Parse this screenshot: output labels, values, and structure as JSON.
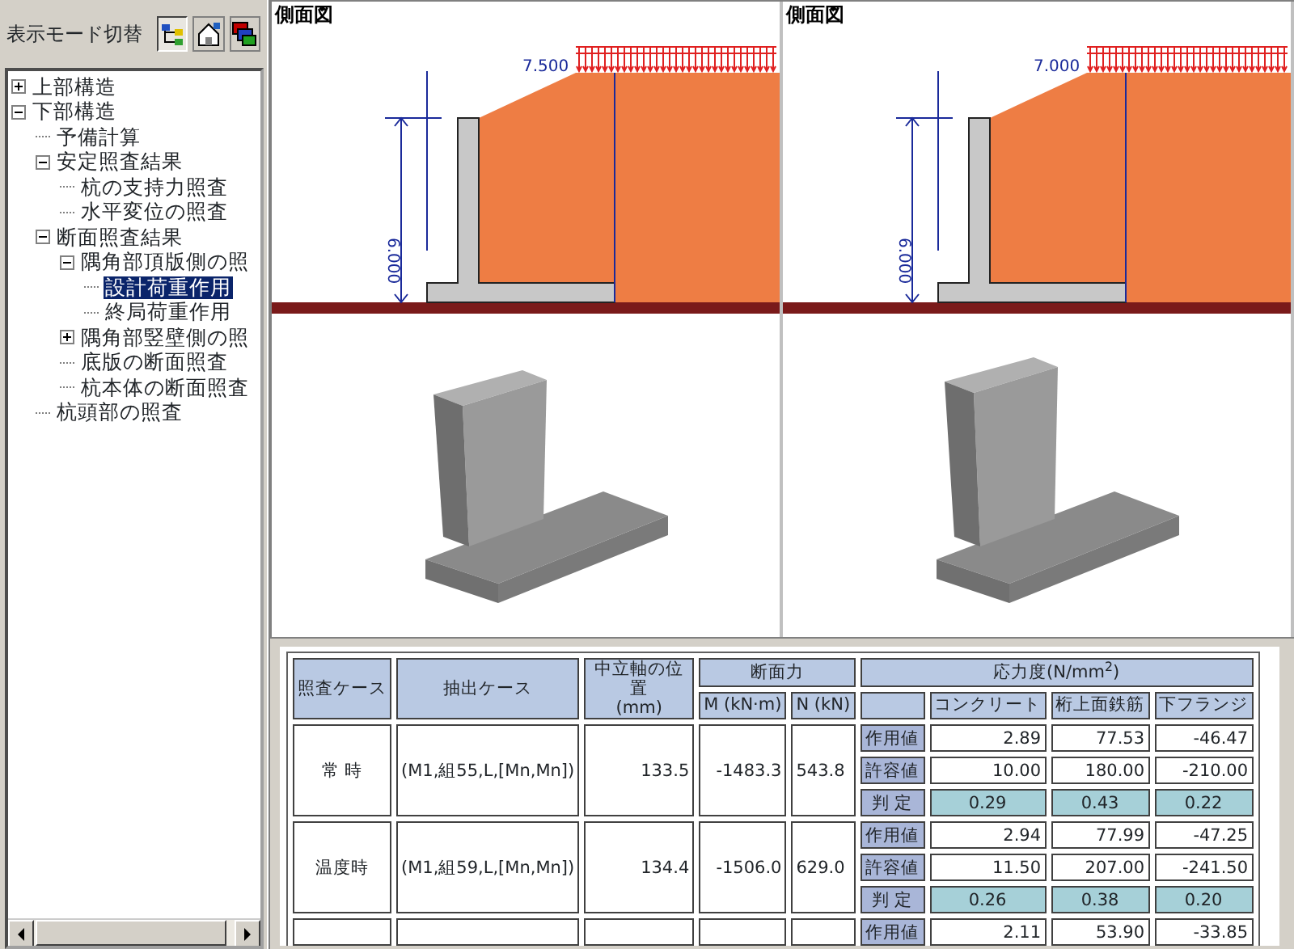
{
  "toolbar": {
    "label": "表示モード切替",
    "buttons": [
      {
        "kind": "tree",
        "selected": true
      },
      {
        "kind": "house",
        "selected": false
      },
      {
        "kind": "layers",
        "selected": false
      }
    ]
  },
  "tree": [
    {
      "label": "上部構造",
      "expanded": false,
      "selected": false
    },
    {
      "label": "下部構造",
      "expanded": true,
      "selected": false,
      "children": [
        {
          "label": "予備計算",
          "selected": false
        },
        {
          "label": "安定照査結果",
          "expanded": true,
          "selected": false,
          "children": [
            {
              "label": "杭の支持力照査",
              "selected": false
            },
            {
              "label": "水平変位の照査",
              "selected": false
            }
          ]
        },
        {
          "label": "断面照査結果",
          "expanded": true,
          "selected": false,
          "children": [
            {
              "label": "隅角部頂版側の照",
              "expanded": true,
              "selected": false,
              "children": [
                {
                  "label": "設計荷重作用",
                  "selected": true
                },
                {
                  "label": "終局荷重作用",
                  "selected": false
                }
              ]
            },
            {
              "label": "隅角部竪壁側の照",
              "expanded": false,
              "selected": false
            },
            {
              "label": "底版の断面照査",
              "selected": false
            },
            {
              "label": "杭本体の断面照査",
              "selected": false
            }
          ]
        },
        {
          "label": "杭頭部の照査",
          "selected": false
        }
      ]
    }
  ],
  "views": [
    {
      "title": "側面図",
      "width_label": "7.500",
      "height_label": "6.000"
    },
    {
      "title": "側面図",
      "width_label": "7.000",
      "height_label": "6.000"
    }
  ],
  "table": {
    "headers": {
      "case": "照査ケース",
      "extract": "抽出ケース",
      "neutral": "中立軸の位置\n(mm)",
      "force": "断面力",
      "moment": "M (kN·m)",
      "axial": "N (kN)",
      "stress": "応力度(N/mm$^{2}$)",
      "stress_cols": [
        "コンクリート",
        "桁上面鉄筋",
        "下フランジ"
      ]
    },
    "rows": [
      {
        "case": "常 時",
        "extract": "(M1,組55,L,[Mn,Mn])",
        "neutral": "133.5",
        "moment": "-1483.3",
        "axial": "543.8",
        "sub": [
          {
            "kind": "value",
            "label": "作用値",
            "values": [
              "2.89",
              "77.53",
              "-46.47"
            ]
          },
          {
            "kind": "value",
            "label": "許容値",
            "values": [
              "10.00",
              "180.00",
              "-210.00"
            ]
          },
          {
            "kind": "ratio",
            "label": "判 定",
            "values": [
              "0.29",
              "0.43",
              "0.22"
            ]
          }
        ]
      },
      {
        "case": "温度時",
        "extract": "(M1,組59,L,[Mn,Mn])",
        "neutral": "134.4",
        "moment": "-1506.0",
        "axial": "629.0",
        "sub": [
          {
            "kind": "value",
            "label": "作用値",
            "values": [
              "2.94",
              "77.99",
              "-47.25"
            ]
          },
          {
            "kind": "value",
            "label": "許容値",
            "values": [
              "11.50",
              "207.00",
              "-241.50"
            ]
          },
          {
            "kind": "ratio",
            "label": "判 定",
            "values": [
              "0.26",
              "0.38",
              "0.20"
            ]
          }
        ]
      },
      {
        "sub": [
          {
            "kind": "value",
            "label": "作用値",
            "values": [
              "2.11",
              "53.90",
              "-33.85"
            ]
          }
        ]
      }
    ]
  }
}
